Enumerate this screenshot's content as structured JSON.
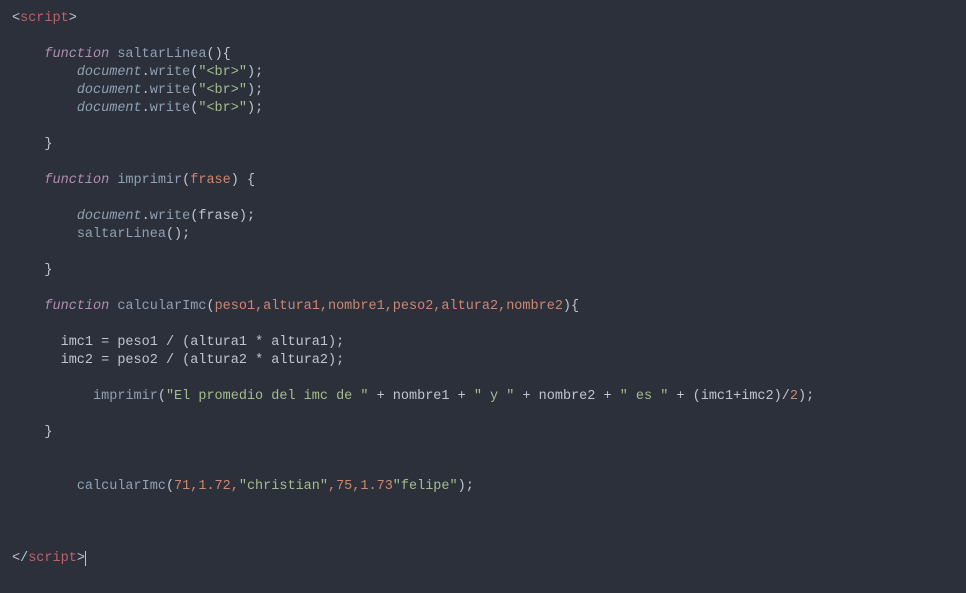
{
  "tag_open_bracket": "<",
  "tag_close_bracket": ">",
  "tag_end_open": "</",
  "script_tag": "script",
  "kw_function": "function",
  "fn_saltarLinea": "saltarLinea",
  "fn_imprimir": "imprimir",
  "fn_calcularImc": "calcularImc",
  "param_frase": "frase",
  "params_calc": "peso1,altura1,nombre1,peso2,altura2,nombre2",
  "obj_document": "document",
  "method_write": "write",
  "str_br": "\"<br>\"",
  "var_frase": "frase",
  "call_saltarLinea": "saltarLinea",
  "var_imc1": "imc1",
  "var_imc2": "imc2",
  "var_peso1": "peso1",
  "var_peso2": "peso2",
  "var_altura1": "altura1",
  "var_altura2": "altura2",
  "var_nombre1": "nombre1",
  "var_nombre2": "nombre2",
  "str_promedio": "\"El promedio del imc de \"",
  "str_y": "\" y \"",
  "str_es": "\" es \"",
  "num_2": "2",
  "call_calc_args_pre": "71,1.72,",
  "str_christian": "\"christian\"",
  "call_calc_args_mid": ",75,1.73",
  "str_felipe": "\"felipe\"",
  "eq": " = ",
  "plus": " + ",
  "div": " / ",
  "star": " * ",
  "lparen": "(",
  "rparen": ")",
  "lbrace": "{",
  "rbrace": "}",
  "semi": ";",
  "comma": ","
}
